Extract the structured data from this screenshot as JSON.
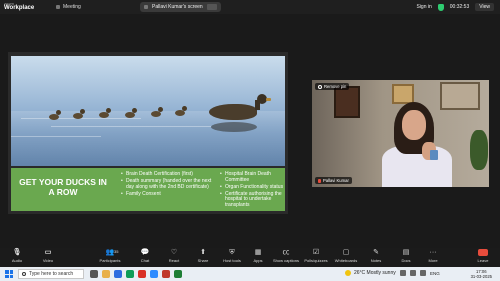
{
  "app": {
    "logo_line1": "zoom",
    "logo_line2": "Workplace",
    "meeting_tab": "Meeting",
    "share_title": "Pallavi Kumar's screen",
    "sign_in": "Sign in",
    "timer": "00:32:53",
    "view": "View"
  },
  "slide": {
    "banner_title": "GET YOUR DUCKS IN A ROW",
    "col1": [
      "Brain Death Certification (first)",
      "Death summary (handed over the next day along with the 2nd BD certificate)",
      "Family Consent"
    ],
    "col2": [
      "Hospital Brain Death Committee",
      "Organ Functionality status",
      "Certificate authorising the hospital to undertake transplants"
    ],
    "colors": {
      "banner": "#6aa84f",
      "text": "#ffffff"
    }
  },
  "participant": {
    "remove_pin": "Remove pin",
    "name": "Pallavi Kumar"
  },
  "toolbar": {
    "items": [
      {
        "name": "audio",
        "label": "Audio",
        "icon": "mic-muted-icon"
      },
      {
        "name": "video",
        "label": "Video",
        "icon": "camera-off-icon"
      },
      {
        "name": "participants",
        "label": "Participants",
        "icon": "people-icon",
        "count": "35"
      },
      {
        "name": "chat",
        "label": "Chat",
        "icon": "chat-icon"
      },
      {
        "name": "react",
        "label": "React",
        "icon": "heart-icon"
      },
      {
        "name": "share",
        "label": "Share",
        "icon": "share-screen-icon"
      },
      {
        "name": "host-tools",
        "label": "Host tools",
        "icon": "shield-icon"
      },
      {
        "name": "apps",
        "label": "Apps",
        "icon": "apps-icon"
      },
      {
        "name": "captions",
        "label": "Show captions",
        "icon": "cc-icon"
      },
      {
        "name": "polls",
        "label": "Polls/quizzes",
        "icon": "poll-icon"
      },
      {
        "name": "whiteboards",
        "label": "Whiteboards",
        "icon": "whiteboard-icon"
      },
      {
        "name": "notes",
        "label": "Notes",
        "icon": "notes-icon"
      },
      {
        "name": "docs",
        "label": "Docs",
        "icon": "docs-icon"
      },
      {
        "name": "more",
        "label": "More",
        "icon": "more-icon"
      }
    ],
    "leave": "Leave"
  },
  "taskbar": {
    "search_placeholder": "Type here to search",
    "weather": "26°C  Mostly sunny",
    "lang": "ENG",
    "time": "17:06",
    "date": "31-03-2025"
  }
}
